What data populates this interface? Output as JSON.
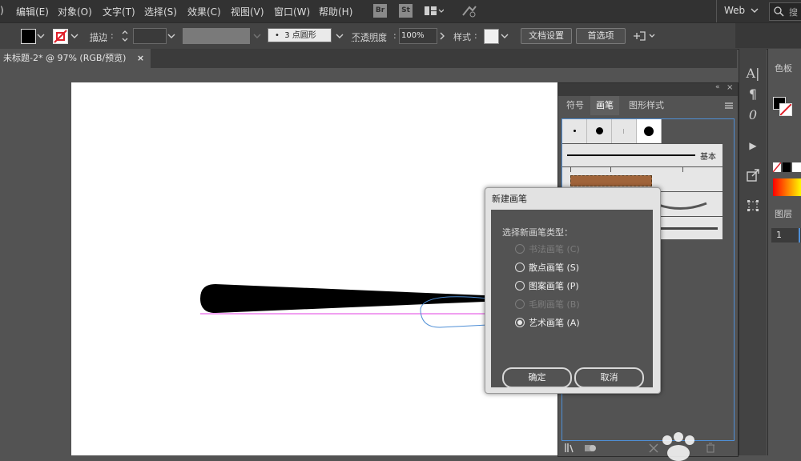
{
  "menubar": {
    "items": [
      ")",
      "编辑(E)",
      "对象(O)",
      "文字(T)",
      "选择(S)",
      "效果(C)",
      "视图(V)",
      "窗口(W)",
      "帮助(H)"
    ],
    "bridge_icon": "Br",
    "stock_icon": "St",
    "workspace": "Web",
    "search_placeholder": "搜"
  },
  "control_bar": {
    "stroke_label": "描边",
    "brush_value": "3 点圆形",
    "opacity_label": "不透明度",
    "opacity_value": "100%",
    "style_label": "样式",
    "doc_setup_button": "文档设置",
    "prefs_button": "首选项"
  },
  "document_tab": {
    "title": "未标题-2* @ 97% (RGB/预览)",
    "close": "×"
  },
  "brush_panel": {
    "tabs": [
      "符号",
      "画笔",
      "图形样式"
    ],
    "active_tab": 1,
    "basic_label": "基本"
  },
  "right_panel": {
    "color_tab": "色板",
    "layers_tab": "图层",
    "layer_number": "1"
  },
  "dialog": {
    "title": "新建画笔",
    "prompt": "选择新画笔类型：",
    "options": [
      {
        "label": "书法画笔 (C)",
        "enabled": false,
        "selected": false
      },
      {
        "label": "散点画笔 (S)",
        "enabled": true,
        "selected": false
      },
      {
        "label": "图案画笔 (P)",
        "enabled": true,
        "selected": false
      },
      {
        "label": "毛刷画笔 (B)",
        "enabled": false,
        "selected": false
      },
      {
        "label": "艺术画笔 (A)",
        "enabled": true,
        "selected": true
      }
    ],
    "ok_button": "确定",
    "cancel_button": "取消"
  },
  "colors": {
    "accent_blue": "#4f8fd6",
    "guide_magenta": "#e040e0"
  }
}
